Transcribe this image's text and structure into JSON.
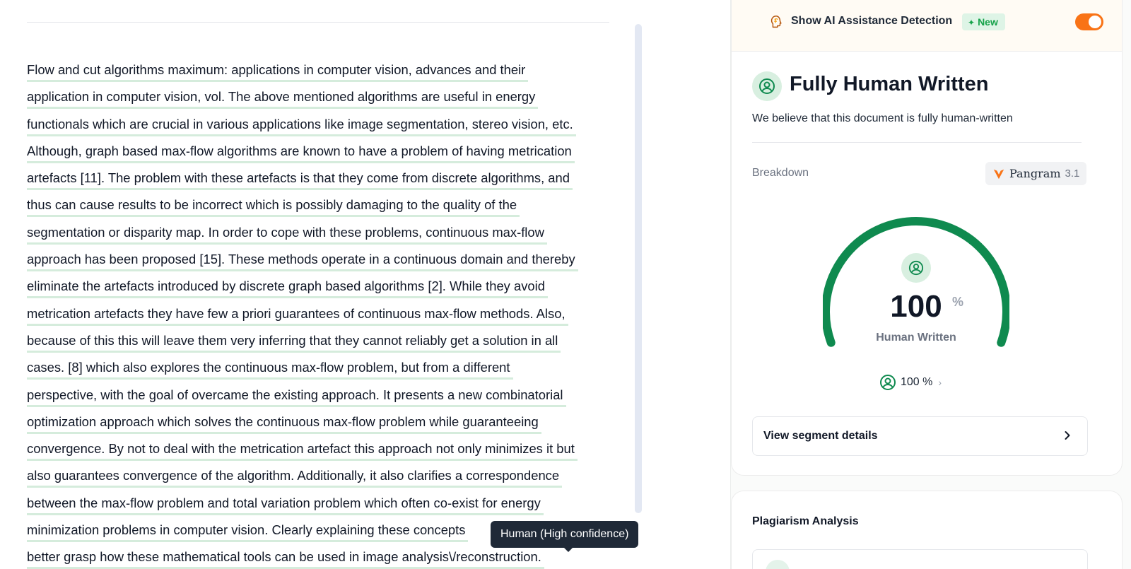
{
  "document": {
    "lines": [
      "Flow and cut algorithms maximum: applications in computer vision, advances and their",
      "application in computer vision, vol. The above mentioned algorithms are useful in energy",
      "functionals which are crucial in various applications like image segmentation, stereo vision, etc.",
      "Although, graph based max-flow algorithms are known to have a problem of having metrication",
      "artefacts [11]. The problem with these artefacts is that they come from discrete algorithms, and",
      "thus can cause results to be incorrect which is possibly damaging to the quality of the",
      "segmentation or disparity map. In order to cope with these problems, continuous max-flow",
      "approach has been proposed [15]. These methods operate in a continuous domain and thereby",
      "eliminate the artefacts introduced by discrete graph based algorithms [2]. While they avoid",
      "metrication artefacts they have few a priori guarantees of continuous max-flow methods. Also,",
      "because of this this will leave them very inferring that they cannot reliably get a solution in all",
      "cases. [8] which also explores the continuous max-flow problem, but from a different",
      "perspective, with the goal of overcame the existing approach. It presents a new combinatorial",
      "optimization approach which solves the continuous max-flow problem while guaranteeing",
      "convergence. By not to deal with the metrication artefact this approach not only minimizes it but",
      "also guarantees convergence of the algorithm. Additionally, it also clarifies a correspondence",
      "between the max-flow problem and total variation problem which often co-exist for energy",
      "minimization problems in computer vision. Clearly explaining these concepts",
      "better grasp how these mathematical tools can be used in image analysis\\/reconstruction."
    ],
    "highlight_color": "#d5ecdc",
    "tooltip": "Human (High confidence)"
  },
  "sidebar": {
    "detection_toggle": {
      "label": "Show AI Assistance Detection",
      "badge": "New",
      "icon": "brain-head-icon",
      "on": true,
      "accent": "#f97316"
    },
    "result": {
      "title": "Fully Human Written",
      "description": "We believe that this document is fully human-written",
      "breakdown_label": "Breakdown",
      "model_name": "Pangram",
      "model_version": "3.1",
      "gauge_value": "100",
      "gauge_unit": "%",
      "gauge_caption": "Human Written",
      "gauge_fraction": 1.0,
      "gauge_color": "#0f8a4f",
      "mini_stat": "100 %",
      "segment_button": "View segment details"
    },
    "plagiarism": {
      "title": "Plagiarism Analysis"
    }
  }
}
